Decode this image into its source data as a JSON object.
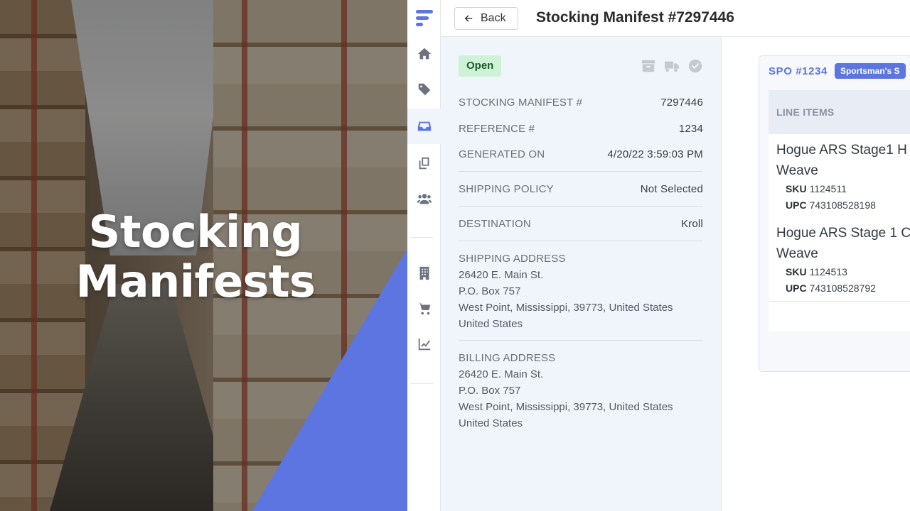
{
  "hero": {
    "title_line1": "Stocking",
    "title_line2": "Manifests"
  },
  "nav": {
    "items": [
      {
        "icon": "home-icon"
      },
      {
        "icon": "tag-icon"
      },
      {
        "icon": "inbox-icon",
        "active": true
      },
      {
        "icon": "copy-icon"
      },
      {
        "icon": "users-icon"
      },
      {
        "icon": "building-icon"
      },
      {
        "icon": "cart-icon"
      },
      {
        "icon": "chart-icon"
      }
    ]
  },
  "header": {
    "back_label": "Back",
    "title": "Stocking Manifest #7297446"
  },
  "details": {
    "status": "Open",
    "status_icons": [
      "archive-icon",
      "truck-icon",
      "check-circle-icon"
    ],
    "rows": [
      {
        "label": "STOCKING MANIFEST #",
        "value": "7297446"
      },
      {
        "label": "REFERENCE #",
        "value": "1234"
      },
      {
        "label": "GENERATED ON",
        "value": "4/20/22 3:59:03 PM"
      },
      {
        "label": "SHIPPING POLICY",
        "value": "Not Selected"
      },
      {
        "label": "DESTINATION",
        "value": "Kroll"
      }
    ],
    "shipping_address": {
      "label": "SHIPPING ADDRESS",
      "line1": "26420 E. Main St.",
      "line2": "P.O. Box 757",
      "line3": "West Point, Mississippi, 39773, United States",
      "line4": "United States"
    },
    "billing_address": {
      "label": "BILLING ADDRESS",
      "line1": "26420 E. Main St.",
      "line2": "P.O. Box 757",
      "line3": "West Point, Mississippi, 39773, United States",
      "line4": "United States"
    }
  },
  "order": {
    "spo": "SPO #1234",
    "vendor": "Sportsman's S",
    "line_items_header": "LINE ITEMS",
    "items": [
      {
        "name_line1": "Hogue ARS Stage1 H",
        "name_line2": "Weave",
        "sku_label": "SKU",
        "sku": "1124511",
        "upc_label": "UPC",
        "upc": "743108528198"
      },
      {
        "name_line1": "Hogue ARS Stage 1 C",
        "name_line2": "Weave",
        "sku_label": "SKU",
        "sku": "1124513",
        "upc_label": "UPC",
        "upc": "743108528792"
      }
    ]
  },
  "colors": {
    "accent": "#5c75e0",
    "open_badge_bg": "#cdf2d6",
    "panel_bg": "#f0f4fb"
  }
}
